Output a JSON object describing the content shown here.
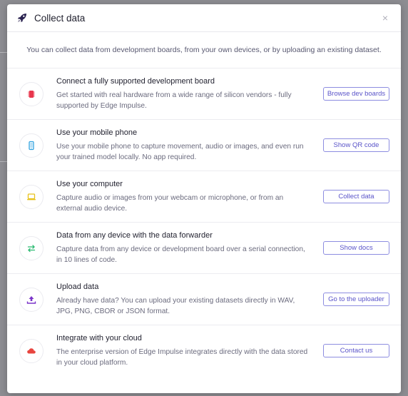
{
  "modal": {
    "title": "Collect data",
    "close_label": "×",
    "intro": "You can collect data from development boards, from your own devices, or by uploading an existing dataset."
  },
  "options": [
    {
      "title": "Connect a fully supported development board",
      "description": "Get started with real hardware from a wide range of silicon vendors - fully supported by Edge Impulse.",
      "button": "Browse dev boards",
      "icon": "chip-icon",
      "icon_color": "#e8364d"
    },
    {
      "title": "Use your mobile phone",
      "description": "Use your mobile phone to capture movement, audio or images, and even run your trained model locally. No app required.",
      "button": "Show QR code",
      "icon": "phone-icon",
      "icon_color": "#33a4e0"
    },
    {
      "title": "Use your computer",
      "description": "Capture audio or images from your webcam or microphone, or from an external audio device.",
      "button": "Collect data",
      "icon": "laptop-icon",
      "icon_color": "#e8c21c"
    },
    {
      "title": "Data from any device with the data forwarder",
      "description": "Capture data from any device or development board over a serial connection, in 10 lines of code.",
      "button": "Show docs",
      "icon": "exchange-icon",
      "icon_color": "#2cba72"
    },
    {
      "title": "Upload data",
      "description": "Already have data? You can upload your existing datasets directly in WAV, JPG, PNG, CBOR or JSON format.",
      "button": "Go to the uploader",
      "icon": "upload-icon",
      "icon_color": "#7b35c9"
    },
    {
      "title": "Integrate with your cloud",
      "description": "The enterprise version of Edge Impulse integrates directly with the data stored in your cloud platform.",
      "button": "Contact us",
      "icon": "cloud-icon",
      "icon_color": "#e8453f"
    }
  ],
  "colors": {
    "accent": "#5a54c9",
    "title_text": "#232331",
    "body_text": "#6b6b7e"
  }
}
